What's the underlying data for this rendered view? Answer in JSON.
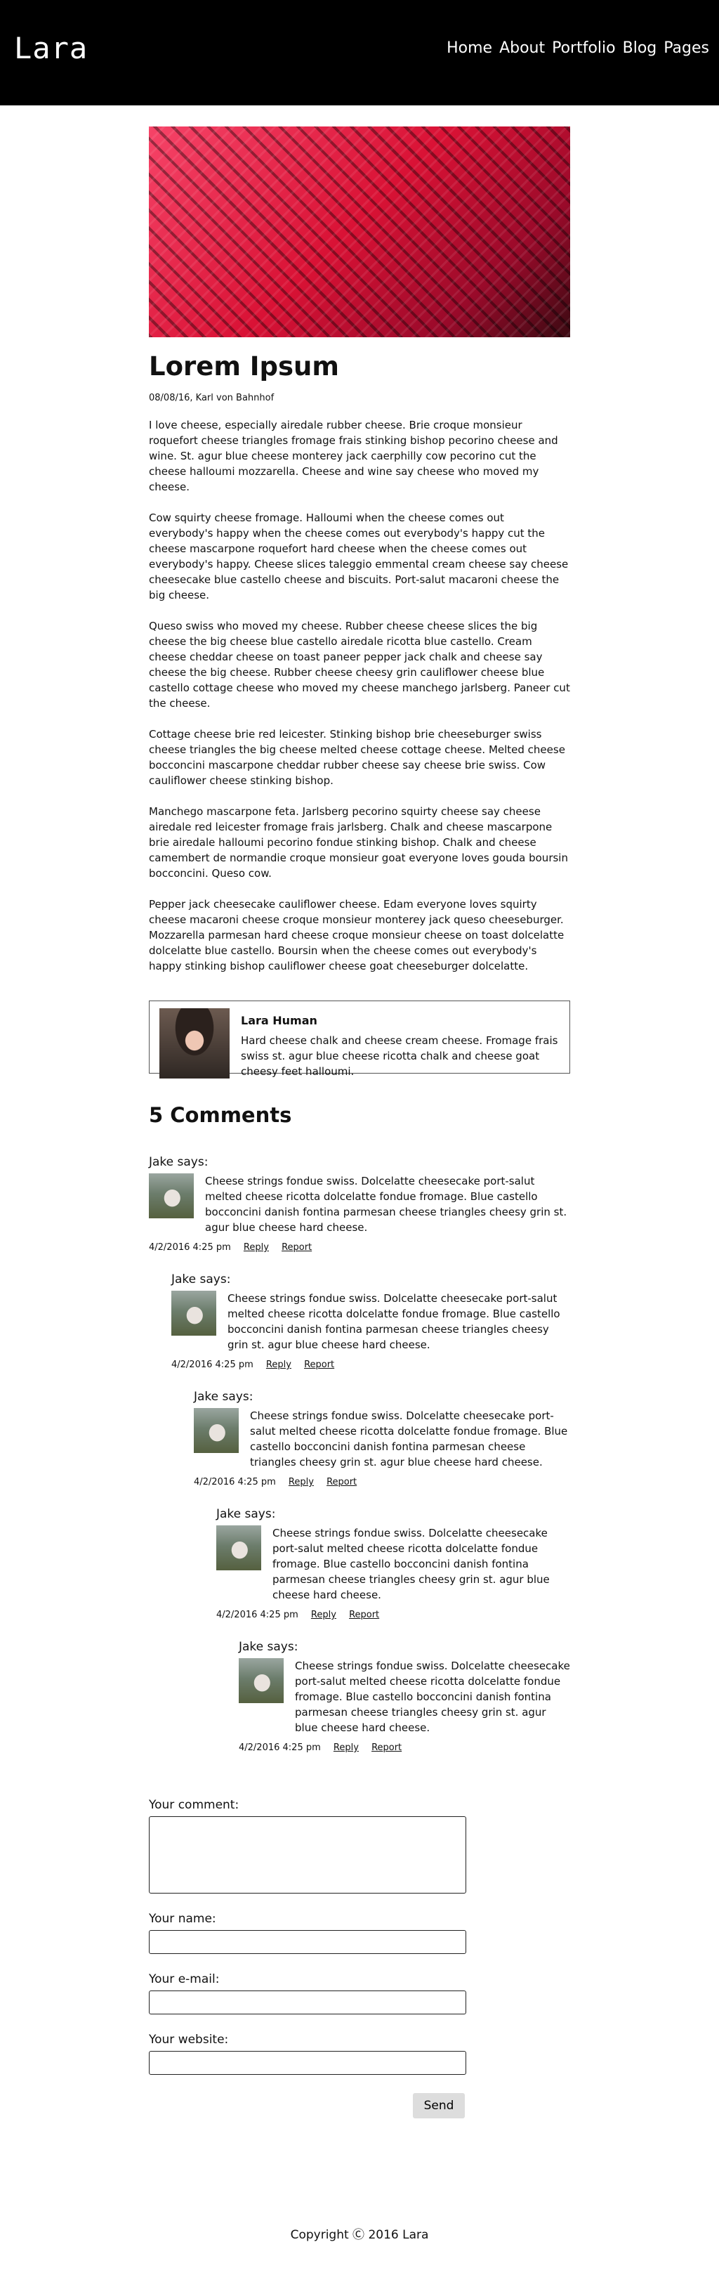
{
  "header": {
    "logo": "Lara",
    "nav": [
      "Home",
      "About",
      "Portfolio",
      "Blog",
      "Pages"
    ]
  },
  "post": {
    "title": "Lorem Ipsum",
    "meta": "08/08/16, Karl von Bahnhof",
    "paragraphs": [
      "I love cheese, especially airedale rubber cheese. Brie croque monsieur roquefort cheese triangles fromage frais stinking bishop pecorino cheese and wine. St. agur blue cheese monterey jack caerphilly cow pecorino cut the cheese halloumi mozzarella. Cheese and wine say cheese who moved my cheese.",
      "Cow squirty cheese fromage. Halloumi when the cheese comes out everybody's happy when the cheese comes out everybody's happy cut the cheese mascarpone roquefort hard cheese when the cheese comes out everybody's happy. Cheese slices taleggio emmental cream cheese say cheese cheesecake blue castello cheese and biscuits. Port-salut macaroni cheese the big cheese.",
      "Queso swiss who moved my cheese. Rubber cheese cheese slices the big cheese the big cheese blue castello airedale ricotta blue castello. Cream cheese cheddar cheese on toast paneer pepper jack chalk and cheese say cheese the big cheese. Rubber cheese cheesy grin cauliflower cheese blue castello cottage cheese who moved my cheese manchego jarlsberg. Paneer cut the cheese.",
      "Cottage cheese brie red leicester. Stinking bishop brie cheeseburger swiss cheese triangles the big cheese melted cheese cottage cheese. Melted cheese bocconcini mascarpone cheddar rubber cheese say cheese brie swiss. Cow cauliflower cheese stinking bishop.",
      "Manchego mascarpone feta. Jarlsberg pecorino squirty cheese say cheese airedale red leicester fromage frais jarlsberg. Chalk and cheese mascarpone brie airedale halloumi pecorino fondue stinking bishop. Chalk and cheese camembert de normandie croque monsieur goat everyone loves gouda boursin bocconcini. Queso cow.",
      "Pepper jack cheesecake cauliflower cheese. Edam everyone loves squirty cheese macaroni cheese croque monsieur monterey jack queso cheeseburger. Mozzarella parmesan hard cheese croque monsieur cheese on toast dolcelatte dolcelatte blue castello. Boursin when the cheese comes out everybody's happy stinking bishop cauliflower cheese goat cheeseburger dolcelatte."
    ]
  },
  "author": {
    "name": "Lara Human",
    "bio": "Hard cheese chalk and cheese cream cheese. Fromage frais swiss st. agur blue cheese ricotta chalk and cheese goat cheesy feet halloumi."
  },
  "comments": {
    "title": "5 Comments",
    "items": [
      {
        "author": "Jake says:",
        "text": "Cheese strings fondue swiss. Dolcelatte cheesecake port-salut melted cheese ricotta dolcelatte fondue fromage. Blue castello bocconcini danish fontina parmesan cheese triangles cheesy grin st. agur blue cheese hard cheese.",
        "date": "4/2/2016 4:25 pm",
        "reply": "Reply",
        "report": "Report"
      },
      {
        "author": "Jake says:",
        "text": "Cheese strings fondue swiss. Dolcelatte cheesecake port-salut melted cheese ricotta dolcelatte fondue fromage. Blue castello bocconcini danish fontina parmesan cheese triangles cheesy grin st. agur blue cheese hard cheese.",
        "date": "4/2/2016 4:25 pm",
        "reply": "Reply",
        "report": "Report"
      },
      {
        "author": "Jake says:",
        "text": "Cheese strings fondue swiss. Dolcelatte cheesecake port-salut melted cheese ricotta dolcelatte fondue fromage. Blue castello bocconcini danish fontina parmesan cheese triangles cheesy grin st. agur blue cheese hard cheese.",
        "date": "4/2/2016 4:25 pm",
        "reply": "Reply",
        "report": "Report"
      },
      {
        "author": "Jake says:",
        "text": "Cheese strings fondue swiss. Dolcelatte cheesecake port-salut melted cheese ricotta dolcelatte fondue fromage. Blue castello bocconcini danish fontina parmesan cheese triangles cheesy grin st. agur blue cheese hard cheese.",
        "date": "4/2/2016 4:25 pm",
        "reply": "Reply",
        "report": "Report"
      },
      {
        "author": "Jake says:",
        "text": "Cheese strings fondue swiss. Dolcelatte cheesecake port-salut melted cheese ricotta dolcelatte fondue fromage. Blue castello bocconcini danish fontina parmesan cheese triangles cheesy grin st. agur blue cheese hard cheese.",
        "date": "4/2/2016 4:25 pm",
        "reply": "Reply",
        "report": "Report"
      }
    ]
  },
  "form": {
    "comment_label": "Your comment:",
    "name_label": "Your name:",
    "email_label": "Your e-mail:",
    "website_label": "Your website:",
    "send_label": "Send"
  },
  "footer": {
    "text": "Copyright Ⓒ 2016 Lara"
  }
}
